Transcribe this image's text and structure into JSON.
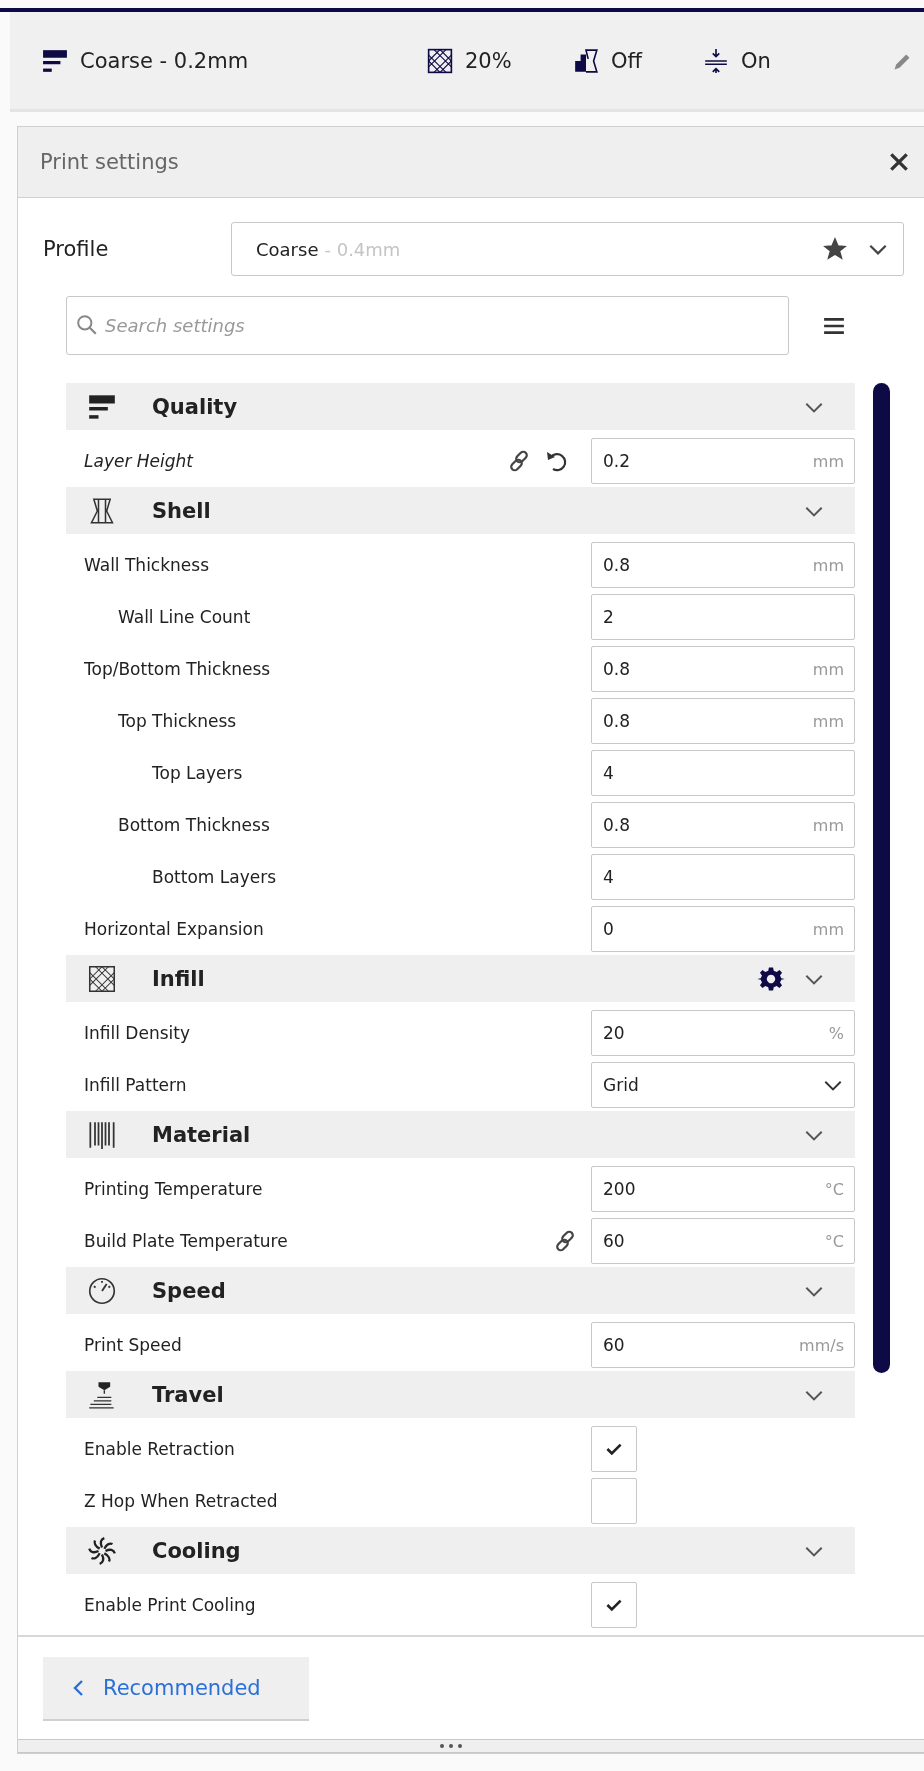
{
  "top_bar": {
    "items": [
      {
        "text": "Coarse - 0.2mm"
      },
      {
        "text": "20%"
      },
      {
        "text": "Off"
      },
      {
        "text": "On"
      }
    ]
  },
  "panel": {
    "title": "Print settings",
    "profile": {
      "label": "Profile",
      "name": "Coarse",
      "detail": "- 0.4mm",
      "favorite": true
    },
    "search": {
      "placeholder": "Search settings"
    },
    "sections": [
      {
        "title": "Quality",
        "expanded": true,
        "gear": false,
        "settings": [
          {
            "label": "Layer Height",
            "kind": "number",
            "value": "0.2",
            "unit": "mm",
            "modified": true,
            "linked": true
          }
        ]
      },
      {
        "title": "Shell",
        "expanded": true,
        "gear": false,
        "settings": [
          {
            "label": "Wall Thickness",
            "kind": "number",
            "value": "0.8",
            "unit": "mm",
            "modified": false,
            "linked": false,
            "children": [
              {
                "label": "Wall Line Count",
                "kind": "number",
                "value": "2",
                "modified": false,
                "linked": false
              }
            ]
          },
          {
            "label": "Top/Bottom Thickness",
            "kind": "number",
            "value": "0.8",
            "unit": "mm",
            "modified": false,
            "linked": false,
            "children": [
              {
                "label": "Top Thickness",
                "kind": "number",
                "value": "0.8",
                "unit": "mm",
                "modified": false,
                "linked": false,
                "children": [
                  {
                    "label": "Top Layers",
                    "kind": "number",
                    "value": "4",
                    "modified": false,
                    "linked": false
                  }
                ]
              },
              {
                "label": "Bottom Thickness",
                "kind": "number",
                "value": "0.8",
                "unit": "mm",
                "modified": false,
                "linked": false,
                "children": [
                  {
                    "label": "Bottom Layers",
                    "kind": "number",
                    "value": "4",
                    "modified": false,
                    "linked": false
                  }
                ]
              }
            ]
          },
          {
            "label": "Horizontal Expansion",
            "kind": "number",
            "value": "0",
            "unit": "mm",
            "modified": false,
            "linked": false
          }
        ]
      },
      {
        "title": "Infill",
        "expanded": true,
        "gear": true,
        "settings": [
          {
            "label": "Infill Density",
            "kind": "number",
            "value": "20",
            "unit": "%",
            "modified": false,
            "linked": false
          },
          {
            "label": "Infill Pattern",
            "kind": "dropdown",
            "value": "Grid",
            "modified": false,
            "linked": false
          }
        ]
      },
      {
        "title": "Material",
        "expanded": true,
        "gear": false,
        "settings": [
          {
            "label": "Printing Temperature",
            "kind": "number",
            "value": "200",
            "unit": "°C",
            "modified": false,
            "linked": false
          },
          {
            "label": "Build Plate Temperature",
            "kind": "number",
            "value": "60",
            "unit": "°C",
            "modified": false,
            "linked": true
          }
        ]
      },
      {
        "title": "Speed",
        "expanded": true,
        "gear": false,
        "settings": [
          {
            "label": "Print Speed",
            "kind": "number",
            "value": "60",
            "unit": "mm/s",
            "modified": false,
            "linked": false
          }
        ]
      },
      {
        "title": "Travel",
        "expanded": true,
        "gear": false,
        "settings": [
          {
            "label": "Enable Retraction",
            "kind": "checkbox",
            "checked": true,
            "modified": false,
            "linked": false
          },
          {
            "label": "Z Hop When Retracted",
            "kind": "checkbox",
            "checked": false,
            "modified": false,
            "linked": false
          }
        ]
      },
      {
        "title": "Cooling",
        "expanded": true,
        "gear": false,
        "settings": [
          {
            "label": "Enable Print Cooling",
            "kind": "checkbox",
            "checked": true,
            "modified": false,
            "linked": false
          }
        ]
      }
    ],
    "footer": {
      "button": "Recommended"
    }
  }
}
